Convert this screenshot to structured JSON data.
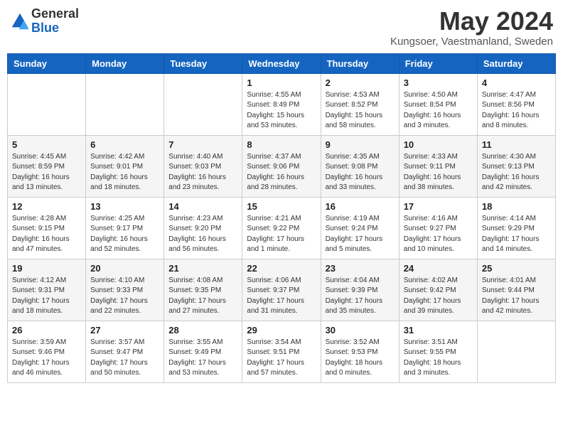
{
  "header": {
    "logo_general": "General",
    "logo_blue": "Blue",
    "month_title": "May 2024",
    "location": "Kungsoer, Vaestmanland, Sweden"
  },
  "weekdays": [
    "Sunday",
    "Monday",
    "Tuesday",
    "Wednesday",
    "Thursday",
    "Friday",
    "Saturday"
  ],
  "weeks": [
    [
      {
        "day": "",
        "info": ""
      },
      {
        "day": "",
        "info": ""
      },
      {
        "day": "",
        "info": ""
      },
      {
        "day": "1",
        "info": "Sunrise: 4:55 AM\nSunset: 8:49 PM\nDaylight: 15 hours\nand 53 minutes."
      },
      {
        "day": "2",
        "info": "Sunrise: 4:53 AM\nSunset: 8:52 PM\nDaylight: 15 hours\nand 58 minutes."
      },
      {
        "day": "3",
        "info": "Sunrise: 4:50 AM\nSunset: 8:54 PM\nDaylight: 16 hours\nand 3 minutes."
      },
      {
        "day": "4",
        "info": "Sunrise: 4:47 AM\nSunset: 8:56 PM\nDaylight: 16 hours\nand 8 minutes."
      }
    ],
    [
      {
        "day": "5",
        "info": "Sunrise: 4:45 AM\nSunset: 8:59 PM\nDaylight: 16 hours\nand 13 minutes."
      },
      {
        "day": "6",
        "info": "Sunrise: 4:42 AM\nSunset: 9:01 PM\nDaylight: 16 hours\nand 18 minutes."
      },
      {
        "day": "7",
        "info": "Sunrise: 4:40 AM\nSunset: 9:03 PM\nDaylight: 16 hours\nand 23 minutes."
      },
      {
        "day": "8",
        "info": "Sunrise: 4:37 AM\nSunset: 9:06 PM\nDaylight: 16 hours\nand 28 minutes."
      },
      {
        "day": "9",
        "info": "Sunrise: 4:35 AM\nSunset: 9:08 PM\nDaylight: 16 hours\nand 33 minutes."
      },
      {
        "day": "10",
        "info": "Sunrise: 4:33 AM\nSunset: 9:11 PM\nDaylight: 16 hours\nand 38 minutes."
      },
      {
        "day": "11",
        "info": "Sunrise: 4:30 AM\nSunset: 9:13 PM\nDaylight: 16 hours\nand 42 minutes."
      }
    ],
    [
      {
        "day": "12",
        "info": "Sunrise: 4:28 AM\nSunset: 9:15 PM\nDaylight: 16 hours\nand 47 minutes."
      },
      {
        "day": "13",
        "info": "Sunrise: 4:25 AM\nSunset: 9:17 PM\nDaylight: 16 hours\nand 52 minutes."
      },
      {
        "day": "14",
        "info": "Sunrise: 4:23 AM\nSunset: 9:20 PM\nDaylight: 16 hours\nand 56 minutes."
      },
      {
        "day": "15",
        "info": "Sunrise: 4:21 AM\nSunset: 9:22 PM\nDaylight: 17 hours\nand 1 minute."
      },
      {
        "day": "16",
        "info": "Sunrise: 4:19 AM\nSunset: 9:24 PM\nDaylight: 17 hours\nand 5 minutes."
      },
      {
        "day": "17",
        "info": "Sunrise: 4:16 AM\nSunset: 9:27 PM\nDaylight: 17 hours\nand 10 minutes."
      },
      {
        "day": "18",
        "info": "Sunrise: 4:14 AM\nSunset: 9:29 PM\nDaylight: 17 hours\nand 14 minutes."
      }
    ],
    [
      {
        "day": "19",
        "info": "Sunrise: 4:12 AM\nSunset: 9:31 PM\nDaylight: 17 hours\nand 18 minutes."
      },
      {
        "day": "20",
        "info": "Sunrise: 4:10 AM\nSunset: 9:33 PM\nDaylight: 17 hours\nand 22 minutes."
      },
      {
        "day": "21",
        "info": "Sunrise: 4:08 AM\nSunset: 9:35 PM\nDaylight: 17 hours\nand 27 minutes."
      },
      {
        "day": "22",
        "info": "Sunrise: 4:06 AM\nSunset: 9:37 PM\nDaylight: 17 hours\nand 31 minutes."
      },
      {
        "day": "23",
        "info": "Sunrise: 4:04 AM\nSunset: 9:39 PM\nDaylight: 17 hours\nand 35 minutes."
      },
      {
        "day": "24",
        "info": "Sunrise: 4:02 AM\nSunset: 9:42 PM\nDaylight: 17 hours\nand 39 minutes."
      },
      {
        "day": "25",
        "info": "Sunrise: 4:01 AM\nSunset: 9:44 PM\nDaylight: 17 hours\nand 42 minutes."
      }
    ],
    [
      {
        "day": "26",
        "info": "Sunrise: 3:59 AM\nSunset: 9:46 PM\nDaylight: 17 hours\nand 46 minutes."
      },
      {
        "day": "27",
        "info": "Sunrise: 3:57 AM\nSunset: 9:47 PM\nDaylight: 17 hours\nand 50 minutes."
      },
      {
        "day": "28",
        "info": "Sunrise: 3:55 AM\nSunset: 9:49 PM\nDaylight: 17 hours\nand 53 minutes."
      },
      {
        "day": "29",
        "info": "Sunrise: 3:54 AM\nSunset: 9:51 PM\nDaylight: 17 hours\nand 57 minutes."
      },
      {
        "day": "30",
        "info": "Sunrise: 3:52 AM\nSunset: 9:53 PM\nDaylight: 18 hours\nand 0 minutes."
      },
      {
        "day": "31",
        "info": "Sunrise: 3:51 AM\nSunset: 9:55 PM\nDaylight: 18 hours\nand 3 minutes."
      },
      {
        "day": "",
        "info": ""
      }
    ]
  ]
}
